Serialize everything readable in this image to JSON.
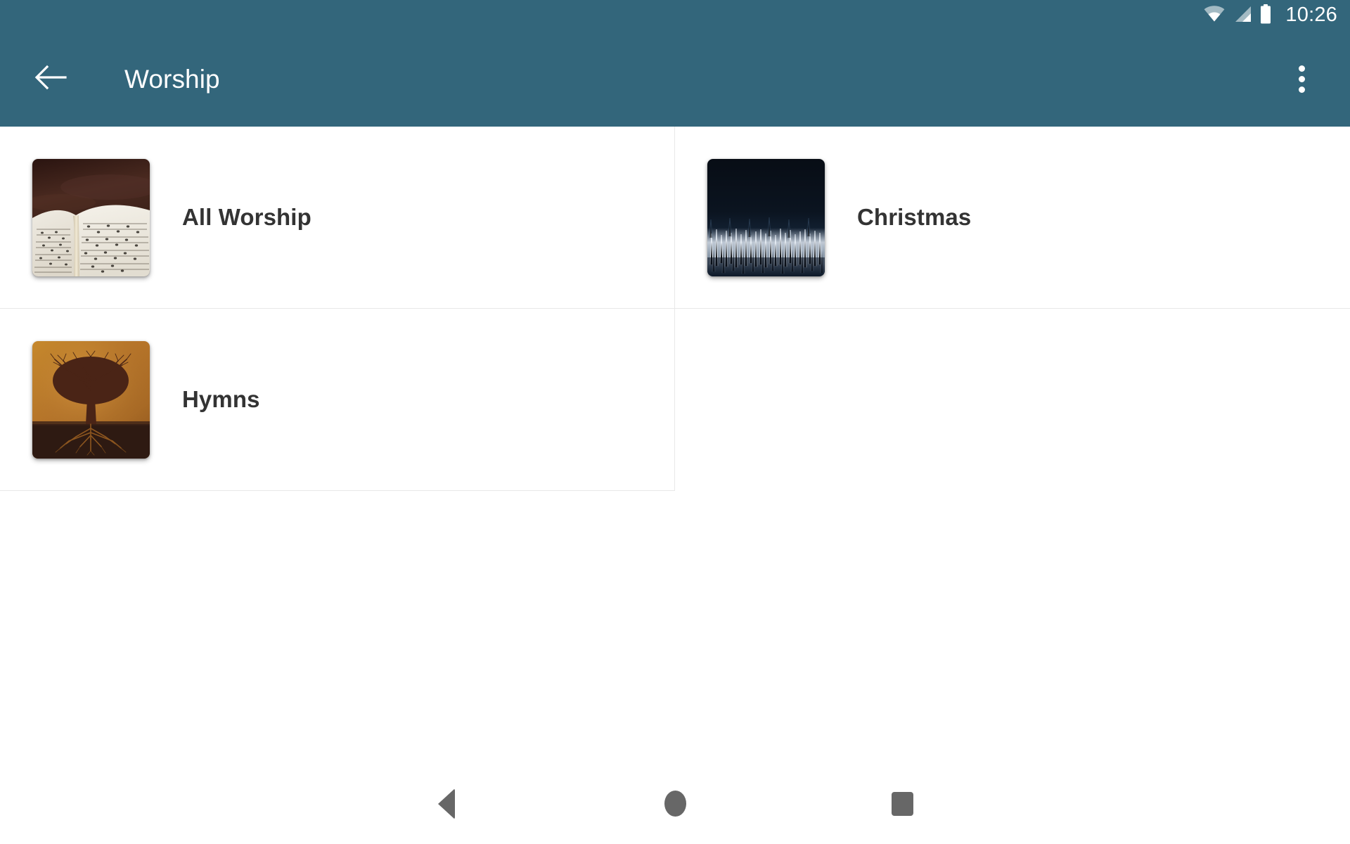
{
  "status_bar": {
    "time": "10:26",
    "icons": [
      "wifi-icon",
      "cellular-signal-icon",
      "battery-icon"
    ]
  },
  "app_bar": {
    "title": "Worship",
    "back_icon": "arrow-back-icon",
    "overflow_icon": "more-vert-icon",
    "background_color": "#33667b"
  },
  "grid": {
    "items": [
      {
        "label": "All Worship",
        "thumbnail": "open-hymnal-book-on-dark-wood-photo"
      },
      {
        "label": "Christmas",
        "thumbnail": "snowy-forest-at-night-photo"
      },
      {
        "label": "Hymns",
        "thumbnail": "tree-with-roots-on-amber-background-photo"
      }
    ]
  },
  "nav_bar": {
    "back_label": "back-button",
    "home_label": "home-button",
    "recents_label": "recent-apps-button"
  }
}
